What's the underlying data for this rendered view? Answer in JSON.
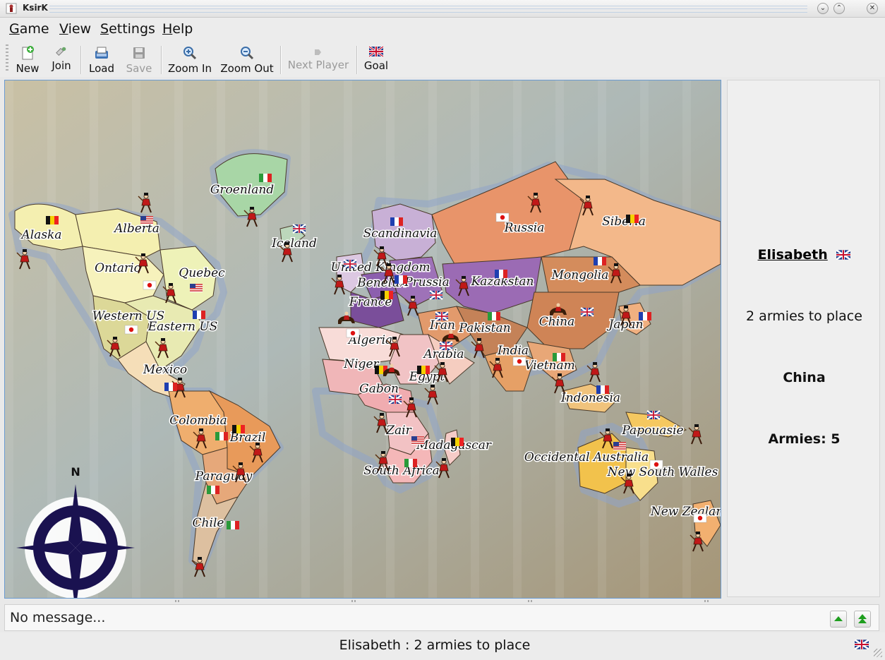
{
  "window": {
    "title": "KsirK"
  },
  "menu": [
    {
      "label": "Game",
      "mnemonic": "G",
      "rest": "ame"
    },
    {
      "label": "View",
      "mnemonic": "V",
      "rest": "iew"
    },
    {
      "label": "Settings",
      "mnemonic": "S",
      "rest": "ettings"
    },
    {
      "label": "Help",
      "mnemonic": "H",
      "rest": "elp"
    }
  ],
  "toolbar": {
    "new": "New",
    "join": "Join",
    "load": "Load",
    "save": "Save",
    "zoom_in": "Zoom In",
    "zoom_out": "Zoom Out",
    "next_player": "Next Player",
    "goal": "Goal"
  },
  "map": {
    "territories": [
      "Alaska",
      "Alberta",
      "Groenland",
      "Iceland",
      "Ontario",
      "Quebec",
      "Western US",
      "Eastern US",
      "Mexico",
      "Colombia",
      "Brazil",
      "Paraguay",
      "Chile",
      "Scandinavia",
      "United Kingdom",
      "Benelux",
      "Prussia",
      "France",
      "Russia",
      "Siberia",
      "Kazakstan",
      "Mongolia",
      "China",
      "Japan",
      "Iran",
      "Pakistan",
      "India",
      "Vietnam",
      "Algeria",
      "Niger",
      "Egypt",
      "Arabia",
      "Gabon",
      "Zair",
      "Madagascar",
      "South Africa",
      "Indonesia",
      "Papouasie",
      "Occidental Australia",
      "New South Walles",
      "New Zealand"
    ],
    "compass_label": "N"
  },
  "side_panel": {
    "player_name": "Elisabeth",
    "armies_to_place": "2 armies to place",
    "country": "China",
    "armies": "Armies: 5"
  },
  "message": "No message...",
  "status": "Elisabeth : 2 armies to place",
  "colors": {
    "accent": "#6b9bd1",
    "compass": "#1a1250",
    "ocean": "#b7c6c3",
    "north_america": "#f3efb5",
    "south_america": "#eaa86a",
    "europe": "#8a5aa8",
    "asia": "#e89a6c",
    "africa": "#f1bfc3",
    "oceania": "#f5c860"
  }
}
